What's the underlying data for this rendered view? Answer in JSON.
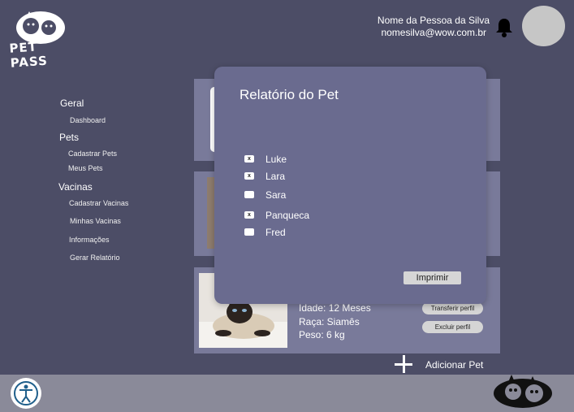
{
  "brand": {
    "logo_text": "PET PASS"
  },
  "user": {
    "name": "Nome da Pessoa da Silva",
    "email": "nomesilva@wow.com.br"
  },
  "sidebar": {
    "sections": [
      {
        "label": "Geral",
        "items": [
          "Dashboard"
        ]
      },
      {
        "label": "Pets",
        "items": [
          "Cadastrar Pets",
          "Meus Pets"
        ]
      },
      {
        "label": "Vacinas",
        "items": [
          "Cadastrar Vacinas",
          "Minhas Vacinas",
          "Informações",
          "Gerar Relatório"
        ]
      }
    ]
  },
  "pet_card": {
    "age": "Idade: 12 Meses",
    "breed": "Raça: Siamês",
    "weight": "Peso: 6 kg",
    "transfer_label": "Transferir perfil",
    "delete_label": "Excluir perfil"
  },
  "add_pet_label": "Adicionar Pet",
  "modal": {
    "title": "Relatório do Pet",
    "pets": [
      {
        "name": "Luke",
        "checked": true,
        "mark": "x"
      },
      {
        "name": "Lara",
        "checked": true,
        "mark": "x"
      },
      {
        "name": "Sara",
        "checked": false,
        "mark": ""
      },
      {
        "name": "Panqueca",
        "checked": true,
        "mark": "x"
      },
      {
        "name": "Fred",
        "checked": false,
        "mark": ""
      }
    ],
    "print_label": "Imprimir"
  },
  "icons": {
    "bell": "bell-icon",
    "accessibility": "accessibility-icon",
    "add": "plus-icon"
  },
  "colors": {
    "background": "#4c4d66",
    "card": "#797a9a",
    "modal": "#6a6b8f",
    "footer": "#8a8a99"
  }
}
